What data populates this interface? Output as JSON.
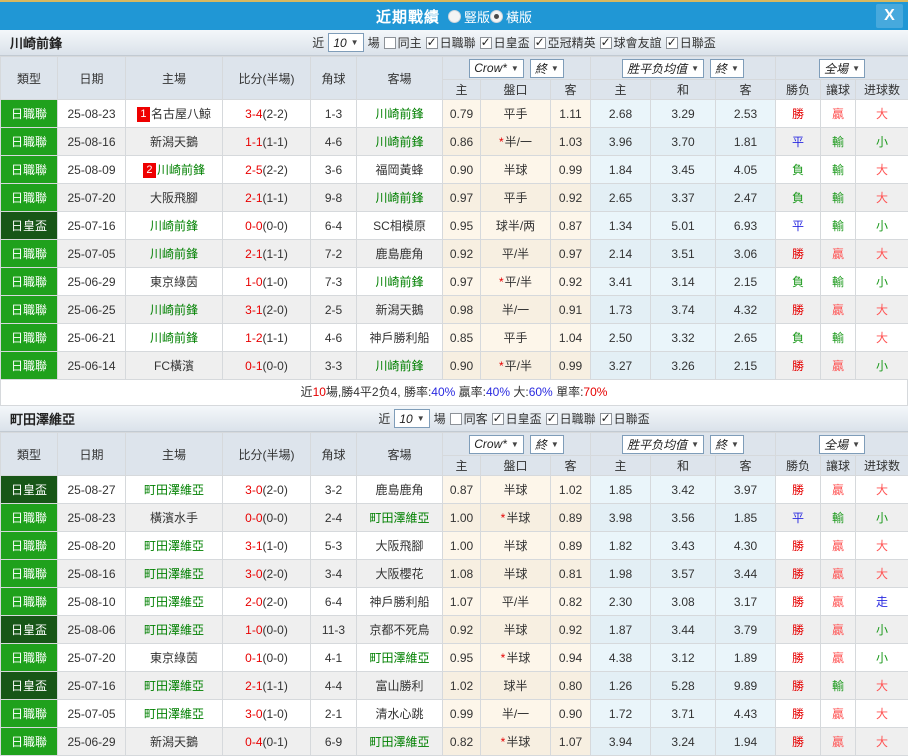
{
  "titlebar": {
    "title": "近期戰績",
    "radios": [
      {
        "id": "vertical",
        "label": "豎版",
        "checked": false
      },
      {
        "id": "horizontal",
        "label": "橫版",
        "checked": true
      }
    ],
    "close_label": "X"
  },
  "filters_ui": {
    "near": "近",
    "games_suffix": "場"
  },
  "header": {
    "main": [
      "類型",
      "日期",
      "主場",
      "比分(半場)",
      "角球",
      "客場"
    ],
    "odds_group": {
      "select": "Crow*",
      "final": "終"
    },
    "avg_group": {
      "select": "胜平负均值",
      "final": "終"
    },
    "full_group": {
      "select": "全場"
    },
    "sub": [
      "主",
      "盤口",
      "客",
      "主",
      "和",
      "客",
      "勝负",
      "讓球",
      "进球数"
    ]
  },
  "sections": [
    {
      "team": "川崎前鋒",
      "filters": {
        "games": "10",
        "same_label": "同主",
        "same_checked": false,
        "leagues": [
          {
            "label": "日職聯",
            "checked": true
          },
          {
            "label": "日皇盃",
            "checked": true
          },
          {
            "label": "亞冠精英",
            "checked": true
          },
          {
            "label": "球會友誼",
            "checked": true
          },
          {
            "label": "日聯盃",
            "checked": true
          }
        ]
      },
      "rows": [
        {
          "type": "日職聯",
          "cup": false,
          "date": "25-08-23",
          "home": "名古屋八鯨",
          "homeGreen": false,
          "badge": "1",
          "score": "3-4",
          "half": "(2-2)",
          "corner": "1-3",
          "away": "川崎前鋒",
          "awayGreen": true,
          "oh": "0.79",
          "star": false,
          "hc": "平手",
          "oa": "1.11",
          "ah": "2.68",
          "ad": "3.29",
          "aa": "2.53",
          "r1": "勝",
          "c1": "red",
          "r2": "贏",
          "c2": "pink",
          "r3": "大",
          "c3": "pink"
        },
        {
          "type": "日職聯",
          "cup": false,
          "date": "25-08-16",
          "home": "新潟天鵝",
          "homeGreen": false,
          "badge": "",
          "score": "1-1",
          "half": "(1-1)",
          "corner": "4-6",
          "away": "川崎前鋒",
          "awayGreen": true,
          "oh": "0.86",
          "star": true,
          "hc": "半/一",
          "oa": "1.03",
          "ah": "3.96",
          "ad": "3.70",
          "aa": "1.81",
          "r1": "平",
          "c1": "blue",
          "r2": "輸",
          "c2": "green",
          "r3": "小",
          "c3": "green"
        },
        {
          "type": "日職聯",
          "cup": false,
          "date": "25-08-09",
          "home": "川崎前鋒",
          "homeGreen": true,
          "badge": "2",
          "score": "2-5",
          "half": "(2-2)",
          "corner": "3-6",
          "away": "福岡黃蜂",
          "awayGreen": false,
          "oh": "0.90",
          "star": false,
          "hc": "半球",
          "oa": "0.99",
          "ah": "1.84",
          "ad": "3.45",
          "aa": "4.05",
          "r1": "負",
          "c1": "green",
          "r2": "輸",
          "c2": "green",
          "r3": "大",
          "c3": "pink"
        },
        {
          "type": "日職聯",
          "cup": false,
          "date": "25-07-20",
          "home": "大阪飛腳",
          "homeGreen": false,
          "badge": "",
          "score": "2-1",
          "half": "(1-1)",
          "corner": "9-8",
          "away": "川崎前鋒",
          "awayGreen": true,
          "oh": "0.97",
          "star": false,
          "hc": "平手",
          "oa": "0.92",
          "ah": "2.65",
          "ad": "3.37",
          "aa": "2.47",
          "r1": "負",
          "c1": "green",
          "r2": "輸",
          "c2": "green",
          "r3": "大",
          "c3": "pink"
        },
        {
          "type": "日皇盃",
          "cup": true,
          "date": "25-07-16",
          "home": "川崎前鋒",
          "homeGreen": true,
          "badge": "",
          "score": "0-0",
          "half": "(0-0)",
          "corner": "6-4",
          "away": "SC相模原",
          "awayGreen": false,
          "oh": "0.95",
          "star": false,
          "hc": "球半/两",
          "oa": "0.87",
          "ah": "1.34",
          "ad": "5.01",
          "aa": "6.93",
          "r1": "平",
          "c1": "blue",
          "r2": "輸",
          "c2": "green",
          "r3": "小",
          "c3": "green"
        },
        {
          "type": "日職聯",
          "cup": false,
          "date": "25-07-05",
          "home": "川崎前鋒",
          "homeGreen": true,
          "badge": "",
          "score": "2-1",
          "half": "(1-1)",
          "corner": "7-2",
          "away": "鹿島鹿角",
          "awayGreen": false,
          "oh": "0.92",
          "star": false,
          "hc": "平/半",
          "oa": "0.97",
          "ah": "2.14",
          "ad": "3.51",
          "aa": "3.06",
          "r1": "勝",
          "c1": "red",
          "r2": "贏",
          "c2": "pink",
          "r3": "大",
          "c3": "pink"
        },
        {
          "type": "日職聯",
          "cup": false,
          "date": "25-06-29",
          "home": "東京綠茵",
          "homeGreen": false,
          "badge": "",
          "score": "1-0",
          "half": "(1-0)",
          "corner": "7-3",
          "away": "川崎前鋒",
          "awayGreen": true,
          "oh": "0.97",
          "star": true,
          "hc": "平/半",
          "oa": "0.92",
          "ah": "3.41",
          "ad": "3.14",
          "aa": "2.15",
          "r1": "負",
          "c1": "green",
          "r2": "輸",
          "c2": "green",
          "r3": "小",
          "c3": "green"
        },
        {
          "type": "日職聯",
          "cup": false,
          "date": "25-06-25",
          "home": "川崎前鋒",
          "homeGreen": true,
          "badge": "",
          "score": "3-1",
          "half": "(2-0)",
          "corner": "2-5",
          "away": "新潟天鵝",
          "awayGreen": false,
          "oh": "0.98",
          "star": false,
          "hc": "半/一",
          "oa": "0.91",
          "ah": "1.73",
          "ad": "3.74",
          "aa": "4.32",
          "r1": "勝",
          "c1": "red",
          "r2": "贏",
          "c2": "pink",
          "r3": "大",
          "c3": "pink"
        },
        {
          "type": "日職聯",
          "cup": false,
          "date": "25-06-21",
          "home": "川崎前鋒",
          "homeGreen": true,
          "badge": "",
          "score": "1-2",
          "half": "(1-1)",
          "corner": "4-6",
          "away": "神戶勝利船",
          "awayGreen": false,
          "oh": "0.85",
          "star": false,
          "hc": "平手",
          "oa": "1.04",
          "ah": "2.50",
          "ad": "3.32",
          "aa": "2.65",
          "r1": "負",
          "c1": "green",
          "r2": "輸",
          "c2": "green",
          "r3": "大",
          "c3": "pink"
        },
        {
          "type": "日職聯",
          "cup": false,
          "date": "25-06-14",
          "home": "FC橫濱",
          "homeGreen": false,
          "badge": "",
          "score": "0-1",
          "half": "(0-0)",
          "corner": "3-3",
          "away": "川崎前鋒",
          "awayGreen": true,
          "oh": "0.90",
          "star": true,
          "hc": "平/半",
          "oa": "0.99",
          "ah": "3.27",
          "ad": "3.26",
          "aa": "2.15",
          "r1": "勝",
          "c1": "red",
          "r2": "贏",
          "c2": "pink",
          "r3": "小",
          "c3": "green"
        }
      ],
      "summary": [
        {
          "text": "近",
          "color": "dark"
        },
        {
          "text": "10",
          "color": "red"
        },
        {
          "text": "場,勝4平2负4, ",
          "color": "dark"
        },
        {
          "text": "勝率:",
          "color": "dark"
        },
        {
          "text": "40%",
          "color": "blue"
        },
        {
          "text": " 贏率:",
          "color": "dark"
        },
        {
          "text": "40%",
          "color": "blue"
        },
        {
          "text": " 大:",
          "color": "dark"
        },
        {
          "text": "60%",
          "color": "blue"
        },
        {
          "text": " 單率:",
          "color": "dark"
        },
        {
          "text": "70%",
          "color": "red"
        }
      ]
    },
    {
      "team": "町田澤維亞",
      "filters": {
        "games": "10",
        "same_label": "同客",
        "same_checked": false,
        "leagues": [
          {
            "label": "日皇盃",
            "checked": true
          },
          {
            "label": "日職聯",
            "checked": true
          },
          {
            "label": "日聯盃",
            "checked": true
          }
        ]
      },
      "rows": [
        {
          "type": "日皇盃",
          "cup": true,
          "date": "25-08-27",
          "home": "町田澤維亞",
          "homeGreen": true,
          "badge": "",
          "score": "3-0",
          "half": "(2-0)",
          "corner": "3-2",
          "away": "鹿島鹿角",
          "awayGreen": false,
          "oh": "0.87",
          "star": false,
          "hc": "半球",
          "oa": "1.02",
          "ah": "1.85",
          "ad": "3.42",
          "aa": "3.97",
          "r1": "勝",
          "c1": "red",
          "r2": "贏",
          "c2": "pink",
          "r3": "大",
          "c3": "pink"
        },
        {
          "type": "日職聯",
          "cup": false,
          "date": "25-08-23",
          "home": "橫濱水手",
          "homeGreen": false,
          "badge": "",
          "score": "0-0",
          "half": "(0-0)",
          "corner": "2-4",
          "away": "町田澤維亞",
          "awayGreen": true,
          "oh": "1.00",
          "star": true,
          "hc": "半球",
          "oa": "0.89",
          "ah": "3.98",
          "ad": "3.56",
          "aa": "1.85",
          "r1": "平",
          "c1": "blue",
          "r2": "輸",
          "c2": "green",
          "r3": "小",
          "c3": "green"
        },
        {
          "type": "日職聯",
          "cup": false,
          "date": "25-08-20",
          "home": "町田澤維亞",
          "homeGreen": true,
          "badge": "",
          "score": "3-1",
          "half": "(1-0)",
          "corner": "5-3",
          "away": "大阪飛腳",
          "awayGreen": false,
          "oh": "1.00",
          "star": false,
          "hc": "半球",
          "oa": "0.89",
          "ah": "1.82",
          "ad": "3.43",
          "aa": "4.30",
          "r1": "勝",
          "c1": "red",
          "r2": "贏",
          "c2": "pink",
          "r3": "大",
          "c3": "pink"
        },
        {
          "type": "日職聯",
          "cup": false,
          "date": "25-08-16",
          "home": "町田澤維亞",
          "homeGreen": true,
          "badge": "",
          "score": "3-0",
          "half": "(2-0)",
          "corner": "3-4",
          "away": "大阪櫻花",
          "awayGreen": false,
          "oh": "1.08",
          "star": false,
          "hc": "半球",
          "oa": "0.81",
          "ah": "1.98",
          "ad": "3.57",
          "aa": "3.44",
          "r1": "勝",
          "c1": "red",
          "r2": "贏",
          "c2": "pink",
          "r3": "大",
          "c3": "pink"
        },
        {
          "type": "日職聯",
          "cup": false,
          "date": "25-08-10",
          "home": "町田澤維亞",
          "homeGreen": true,
          "badge": "",
          "score": "2-0",
          "half": "(2-0)",
          "corner": "6-4",
          "away": "神戶勝利船",
          "awayGreen": false,
          "oh": "1.07",
          "star": false,
          "hc": "平/半",
          "oa": "0.82",
          "ah": "2.30",
          "ad": "3.08",
          "aa": "3.17",
          "r1": "勝",
          "c1": "red",
          "r2": "贏",
          "c2": "pink",
          "r3": "走",
          "c3": "blue"
        },
        {
          "type": "日皇盃",
          "cup": true,
          "date": "25-08-06",
          "home": "町田澤維亞",
          "homeGreen": true,
          "badge": "",
          "score": "1-0",
          "half": "(0-0)",
          "corner": "11-3",
          "away": "京都不死鳥",
          "awayGreen": false,
          "oh": "0.92",
          "star": false,
          "hc": "半球",
          "oa": "0.92",
          "ah": "1.87",
          "ad": "3.44",
          "aa": "3.79",
          "r1": "勝",
          "c1": "red",
          "r2": "贏",
          "c2": "pink",
          "r3": "小",
          "c3": "green"
        },
        {
          "type": "日職聯",
          "cup": false,
          "date": "25-07-20",
          "home": "東京綠茵",
          "homeGreen": false,
          "badge": "",
          "score": "0-1",
          "half": "(0-0)",
          "corner": "4-1",
          "away": "町田澤維亞",
          "awayGreen": true,
          "oh": "0.95",
          "star": true,
          "hc": "半球",
          "oa": "0.94",
          "ah": "4.38",
          "ad": "3.12",
          "aa": "1.89",
          "r1": "勝",
          "c1": "red",
          "r2": "贏",
          "c2": "pink",
          "r3": "小",
          "c3": "green"
        },
        {
          "type": "日皇盃",
          "cup": true,
          "date": "25-07-16",
          "home": "町田澤維亞",
          "homeGreen": true,
          "badge": "",
          "score": "2-1",
          "half": "(1-1)",
          "corner": "4-4",
          "away": "富山勝利",
          "awayGreen": false,
          "oh": "1.02",
          "star": false,
          "hc": "球半",
          "oa": "0.80",
          "ah": "1.26",
          "ad": "5.28",
          "aa": "9.89",
          "r1": "勝",
          "c1": "red",
          "r2": "輸",
          "c2": "green",
          "r3": "大",
          "c3": "pink"
        },
        {
          "type": "日職聯",
          "cup": false,
          "date": "25-07-05",
          "home": "町田澤維亞",
          "homeGreen": true,
          "badge": "",
          "score": "3-0",
          "half": "(1-0)",
          "corner": "2-1",
          "away": "清水心跳",
          "awayGreen": false,
          "oh": "0.99",
          "star": false,
          "hc": "半/一",
          "oa": "0.90",
          "ah": "1.72",
          "ad": "3.71",
          "aa": "4.43",
          "r1": "勝",
          "c1": "red",
          "r2": "贏",
          "c2": "pink",
          "r3": "大",
          "c3": "pink"
        },
        {
          "type": "日職聯",
          "cup": false,
          "date": "25-06-29",
          "home": "新潟天鵝",
          "homeGreen": false,
          "badge": "",
          "score": "0-4",
          "half": "(0-1)",
          "corner": "6-9",
          "away": "町田澤維亞",
          "awayGreen": true,
          "oh": "0.82",
          "star": true,
          "hc": "半球",
          "oa": "1.07",
          "ah": "3.94",
          "ad": "3.24",
          "aa": "1.94",
          "r1": "勝",
          "c1": "red",
          "r2": "贏",
          "c2": "pink",
          "r3": "大",
          "c3": "pink"
        }
      ],
      "summary": null
    }
  ]
}
